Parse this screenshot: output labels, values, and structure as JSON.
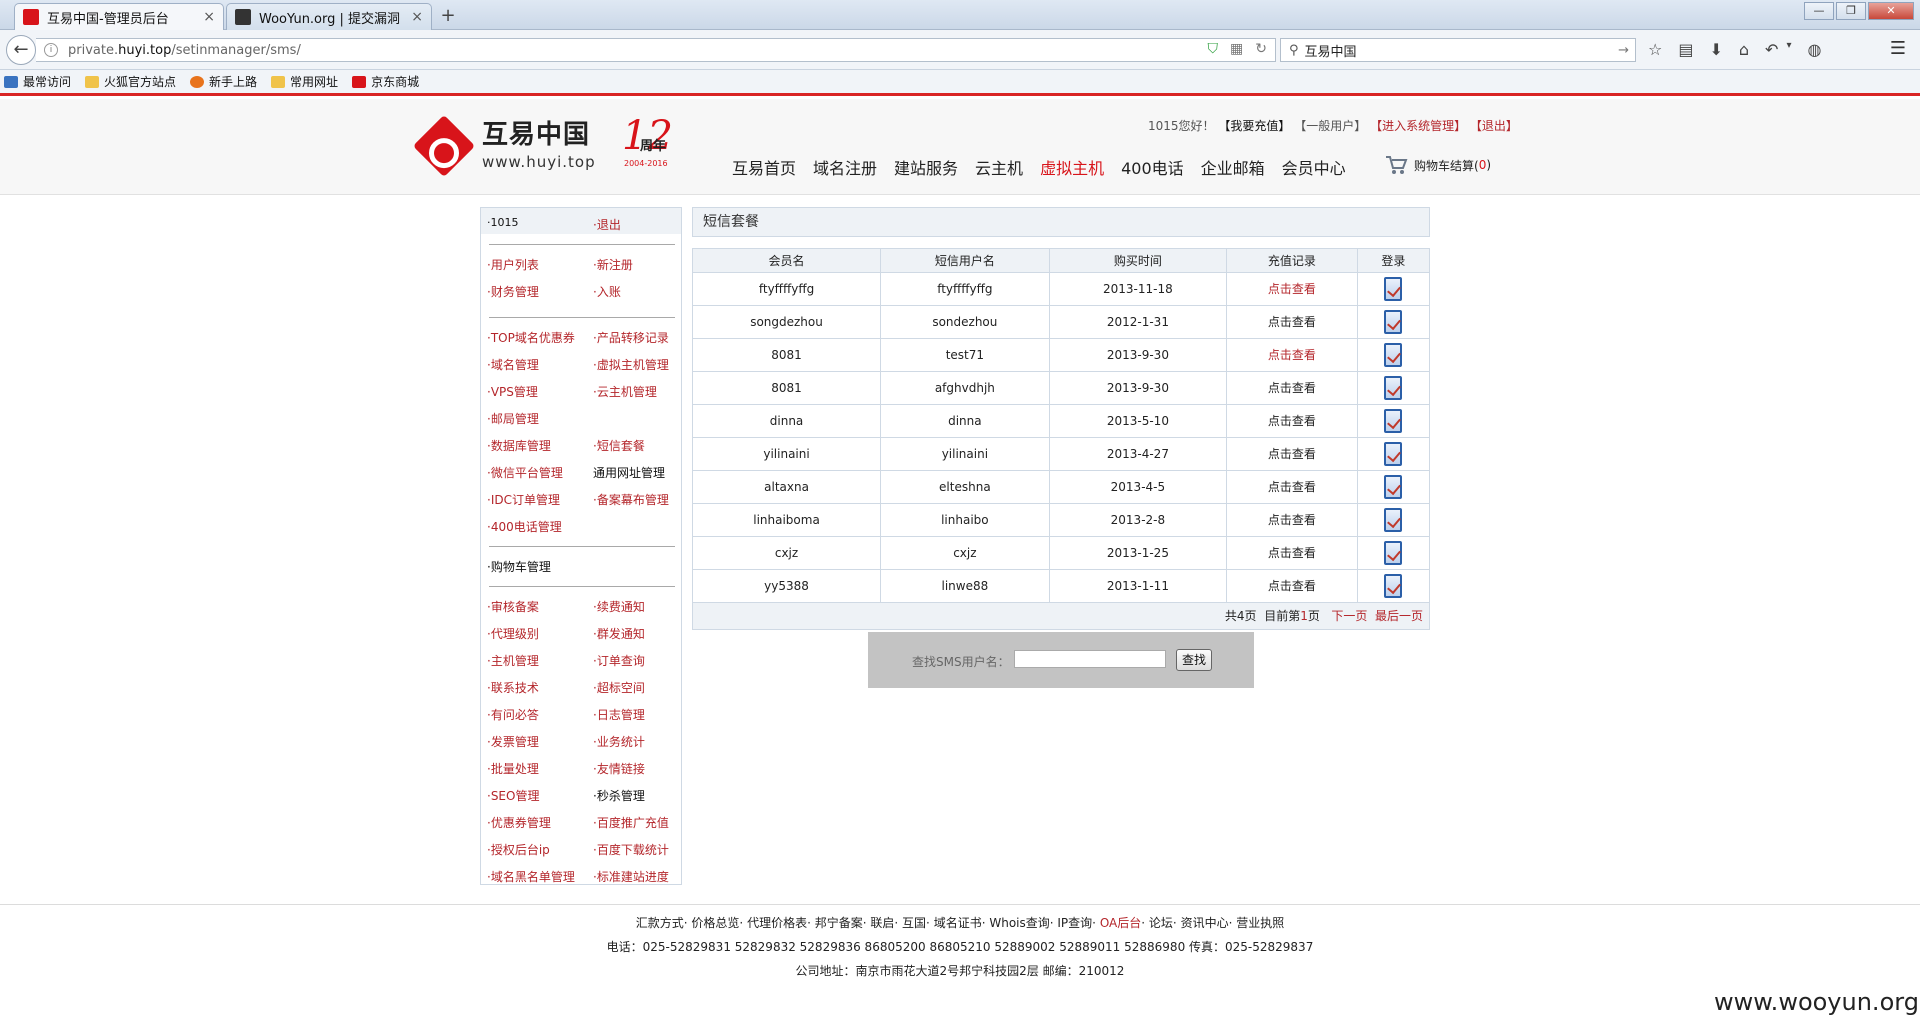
{
  "browser": {
    "tabs": [
      {
        "title": "互易中国-管理员后台",
        "active": true
      },
      {
        "title": "WooYun.org | 提交漏洞",
        "active": false
      }
    ],
    "url_prefix": "private.",
    "url_host": "huyi.top",
    "url_path": "/setinmanager/sms/",
    "search_value": "互易中国",
    "bookmarks": [
      "最常访问",
      "火狐官方站点",
      "新手上路",
      "常用网址",
      "京东商城"
    ]
  },
  "header": {
    "logo_cn": "互易中国",
    "logo_en": "www.huyi.top",
    "anniversary_label": "周年",
    "anniversary_years": "2004-2016",
    "greeting": "1015您好！",
    "recharge": "【我要充值】",
    "user_type": "【一般用户】",
    "enter_admin": "【进入系统管理】",
    "logout": "【退出】",
    "nav": [
      "互易首页",
      "域名注册",
      "建站服务",
      "云主机",
      "虚拟主机",
      "400电话",
      "企业邮箱",
      "会员中心"
    ],
    "cart_label": "购物车结算(",
    "cart_count": "0",
    "cart_close": ")"
  },
  "sidebar": {
    "user": "·1015",
    "logout": "·退出",
    "g1": [
      "·用户列表",
      "·新注册",
      "·财务管理",
      "·入账"
    ],
    "g2": [
      "·TOP域名优惠券",
      "·产品转移记录",
      "·域名管理",
      "·虚拟主机管理",
      "·VPS管理",
      "·云主机管理",
      "·邮局管理",
      "·数据库管理",
      "·短信套餐",
      "·微信平台管理",
      "通用网址管理",
      "·IDC订单管理",
      "·备案幕布管理",
      "·400电话管理"
    ],
    "g3": "·购物车管理",
    "g4": [
      "·审核备案",
      "·续费通知",
      "·代理级别",
      "·群发通知",
      "·主机管理",
      "·订单查询",
      "·联系技术",
      "·超标空间",
      "·有问必答",
      "·日志管理",
      "·发票管理",
      "·业务统计",
      "·批量处理",
      "·友情链接",
      "·SEO管理",
      "·秒杀管理",
      "·优惠券管理",
      "·百度推广充值",
      "·授权后台ip",
      "·百度下载统计",
      "·域名黑名单管理",
      "·标准建站进度"
    ]
  },
  "main": {
    "panel_title": "短信套餐",
    "columns": [
      "会员名",
      "短信用户名",
      "购买时间",
      "充值记录",
      "登录"
    ],
    "rows": [
      {
        "member": "ftyffffyffg",
        "sms_user": "ftyffffyffg",
        "date": "2013-11-18",
        "record": "点击查看",
        "visited": true
      },
      {
        "member": "songdezhou",
        "sms_user": "sondezhou",
        "date": "2012-1-31",
        "record": "点击查看",
        "visited": false
      },
      {
        "member": "8081",
        "sms_user": "test71",
        "date": "2013-9-30",
        "record": "点击查看",
        "visited": true
      },
      {
        "member": "8081",
        "sms_user": "afghvdhjh",
        "date": "2013-9-30",
        "record": "点击查看",
        "visited": false
      },
      {
        "member": "dinna",
        "sms_user": "dinna",
        "date": "2013-5-10",
        "record": "点击查看",
        "visited": false
      },
      {
        "member": "yilinaini",
        "sms_user": "yilinaini",
        "date": "2013-4-27",
        "record": "点击查看",
        "visited": false
      },
      {
        "member": "altaxna",
        "sms_user": "elteshna",
        "date": "2013-4-5",
        "record": "点击查看",
        "visited": false
      },
      {
        "member": "linhaiboma",
        "sms_user": "linhaibo",
        "date": "2013-2-8",
        "record": "点击查看",
        "visited": false
      },
      {
        "member": "cxjz",
        "sms_user": "cxjz",
        "date": "2013-1-25",
        "record": "点击查看",
        "visited": false
      },
      {
        "member": "yy5388",
        "sms_user": "linwe88",
        "date": "2013-1-11",
        "record": "点击查看",
        "visited": false
      }
    ],
    "pager": {
      "total": "共4页",
      "current_prefix": "目前第",
      "current": "1",
      "current_suffix": "页",
      "next": "下一页",
      "last": "最后一页"
    },
    "search_label": "查找SMS用户名：",
    "search_value": "",
    "search_button": "查找"
  },
  "footer": {
    "links": [
      "汇款方式",
      "价格总览",
      "代理价格表",
      "邦宁备案",
      "联启",
      "互国",
      "域名证书",
      "Whois查询",
      "IP查询",
      "OA后台",
      "论坛",
      "资讯中心",
      "营业执照"
    ],
    "phone": "电话：025-52829831 52829832 52829836 86805200 86805210 52889002 52889011 52886980   传真：025-52829837",
    "address": "公司地址：南京市雨花大道2号邦宁科技园2层 邮编：210012"
  },
  "watermark": "www.wooyun.org",
  "colors": {
    "brand_red": "#d8141a",
    "link_red": "#b4262b",
    "panel_bg": "#eef2f6",
    "border": "#cfd9e4"
  }
}
